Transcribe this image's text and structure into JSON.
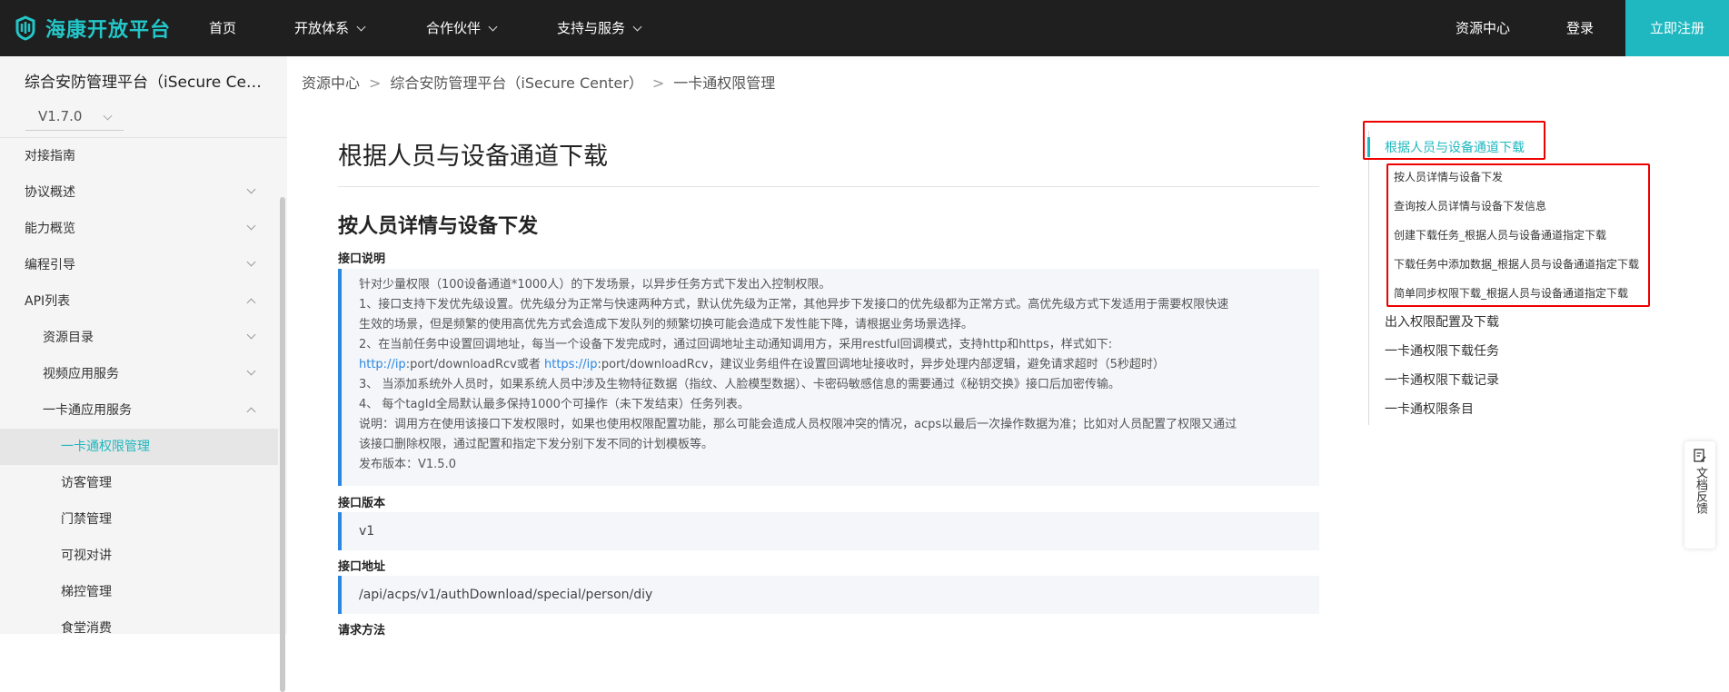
{
  "nav": {
    "brand": "海康开放平台",
    "items": [
      "首页",
      "开放体系",
      "合作伙伴",
      "支持与服务"
    ],
    "resource_center": "资源中心",
    "login": "登录",
    "register": "立即注册"
  },
  "sidebar": {
    "platform_title": "综合安防管理平台（iSecure Cent...",
    "version": "V1.7.0",
    "items": [
      {
        "label": "对接指南"
      },
      {
        "label": "协议概述"
      },
      {
        "label": "能力概览"
      },
      {
        "label": "编程引导"
      },
      {
        "label": "API列表"
      },
      {
        "label": "资源目录"
      },
      {
        "label": "视频应用服务"
      },
      {
        "label": "一卡通应用服务"
      },
      {
        "label": "一卡通权限管理"
      },
      {
        "label": "访客管理"
      },
      {
        "label": "门禁管理"
      },
      {
        "label": "可视对讲"
      },
      {
        "label": "梯控管理"
      },
      {
        "label": "食堂消费"
      }
    ]
  },
  "breadcrumb": [
    "资源中心",
    "综合安防管理平台（iSecure Center）",
    "一卡通权限管理"
  ],
  "main": {
    "page_title": "根据人员与设备通道下载",
    "section_title": "按人员详情与设备下发",
    "labels": {
      "desc": "接口说明",
      "version": "接口版本",
      "address": "接口地址",
      "method": "请求方法"
    },
    "desc_lines": {
      "l1": "针对少量权限（100设备通道*1000人）的下发场景，以异步任务方式下发出入控制权限。",
      "l2": "1、接口支持下发优先级设置。优先级分为正常与快速两种方式，默认优先级为正常，其他异步下发接口的优先级都为正常方式。高优先级方式下发适用于需要权限快速",
      "l3": "生效的场景，但是频繁的使用高优先方式会造成下发队列的频繁切换可能会造成下发性能下降，请根据业务场景选择。",
      "l4": "2、在当前任务中设置回调地址，每当一个设备下发完成时，通过回调地址主动通知调用方，采用restful回调模式，支持http和https，样式如下:",
      "l5_link1": "http://ip",
      "l5_text1": ":port/downloadRcv或者 ",
      "l5_link2": "https://ip",
      "l5_text2": ":port/downloadRcv，建议业务组件在设置回调地址接收时，异步处理内部逻辑，避免请求超时（5秒超时）",
      "l6": "3、 当添加系统外人员时，如果系统人员中涉及生物特征数据（指纹、人脸模型数据）、卡密码敏感信息的需要通过《秘钥交换》接口后加密传输。",
      "l7": "4、 每个tagId全局默认最多保持1000个可操作（未下发结束）任务列表。",
      "l8": "说明：调用方在使用该接口下发权限时，如果也使用权限配置功能，那么可能会造成人员权限冲突的情况，acps以最后一次操作数据为准；比如对人员配置了权限又通过",
      "l9": "该接口删除权限，通过配置和指定下发分别下发不同的计划模板等。",
      "l10": "发布版本：V1.5.0"
    },
    "version_value": "v1",
    "address_value": "/api/acps/v1/authDownload/special/person/diy"
  },
  "toc": {
    "active": "根据人员与设备通道下载",
    "sub": [
      "按人员详情与设备下发",
      "查询按人员详情与设备下发信息",
      "创建下载任务_根据人员与设备通道指定下载",
      "下载任务中添加数据_根据人员与设备通道指定下载",
      "简单同步权限下载_根据人员与设备通道指定下载"
    ],
    "others": [
      "出入权限配置及下载",
      "一卡通权限下载任务",
      "一卡通权限下载记录",
      "一卡通权限条目"
    ]
  },
  "feedback": {
    "label": "文档反馈"
  },
  "colors": {
    "accent": "#1fb8c0",
    "nav_bg": "#1f1f1f",
    "link": "#2b87e0",
    "highlight_box": "#e00000"
  }
}
